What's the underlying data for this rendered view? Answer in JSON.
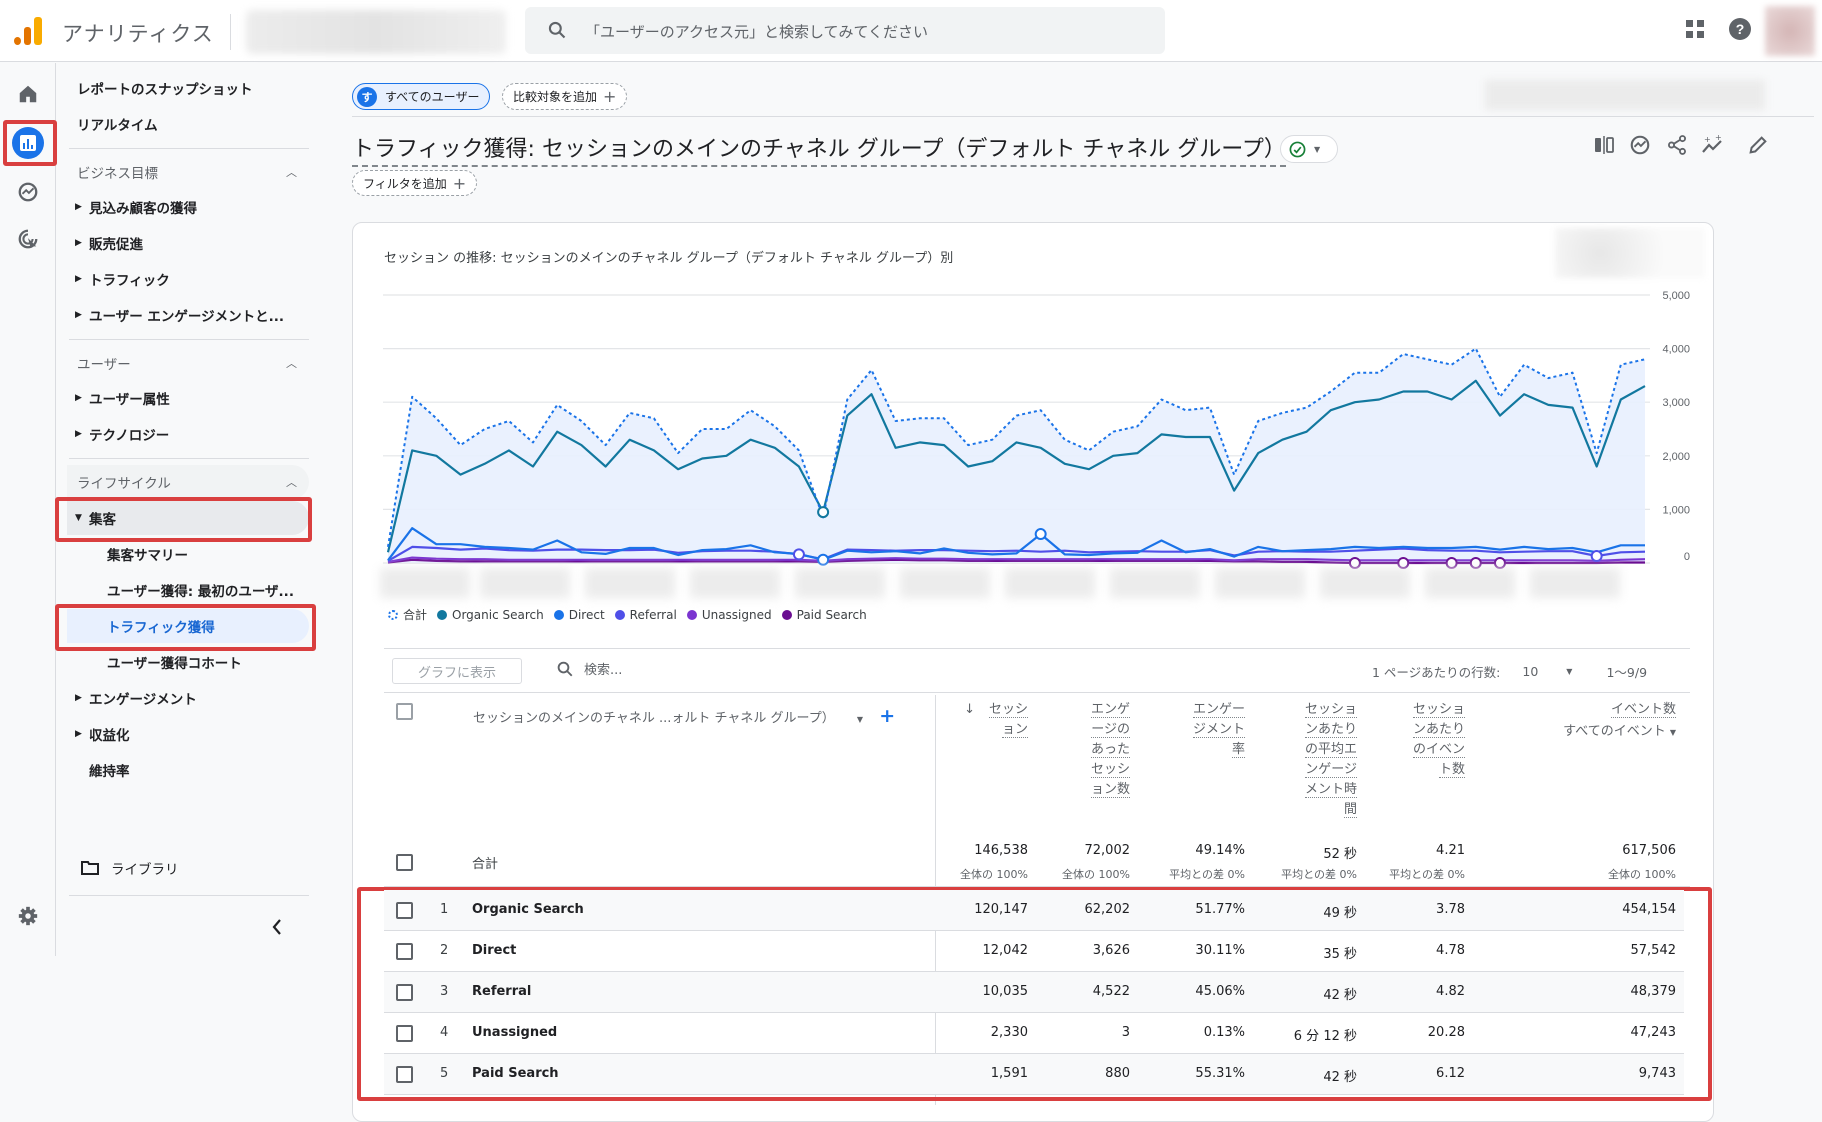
{
  "app": {
    "title": "アナリティクス",
    "search_placeholder": "「ユーザーのアクセス元」と検索してみてください",
    "brand_colors": {
      "orange": "#f9ab00",
      "dark_orange": "#e37400",
      "accent": "#1a73e8"
    }
  },
  "rail": {
    "items": [
      {
        "name": "home",
        "icon": "home-icon"
      },
      {
        "name": "reports",
        "icon": "bar-chart-icon",
        "active": true
      },
      {
        "name": "explore",
        "icon": "explore-trend-icon"
      },
      {
        "name": "advertising",
        "icon": "target-cursor-icon"
      },
      {
        "name": "admin",
        "icon": "gear-icon"
      }
    ]
  },
  "nav": {
    "top_items": [
      "レポートのスナップショット",
      "リアルタイム"
    ],
    "sections": [
      {
        "label": "ビジネス目標",
        "items": [
          "見込み顧客の獲得",
          "販売促進",
          "トラフィック",
          "ユーザー エンゲージメントと..."
        ]
      },
      {
        "label": "ユーザー",
        "items": [
          "ユーザー属性",
          "テクノロジー"
        ]
      },
      {
        "label": "ライフサイクル",
        "expanded_item": "集客",
        "sub_items": [
          "集客サマリー",
          "ユーザー獲得: 最初のユーザ...",
          "トラフィック獲得",
          "ユーザー獲得コホート"
        ],
        "active_sub_item": "トラフィック獲得",
        "items_after": [
          "エンゲージメント",
          "収益化",
          "維持率"
        ]
      }
    ],
    "library": "ライブラリ"
  },
  "header": {
    "segment_chip": "すべてのユーザー",
    "segment_badge": "す",
    "compare_chip": "比較対象を追加",
    "page_title": "トラフィック獲得: セッションのメインのチャネル グループ（デフォルト チャネル グループ）",
    "filter_chip": "フィルタを追加"
  },
  "chart_data": {
    "type": "line",
    "title": "セッション の推移: セッションのメインのチャネル グループ（デフォルト チャネル グループ）別",
    "xlabel": "",
    "ylabel": "",
    "ylim": [
      0,
      5000
    ],
    "y_ticks": [
      "5,000",
      "4,000",
      "3,000",
      "2,000",
      "1,000",
      "0"
    ],
    "y_tick_values": [
      5000,
      4000,
      3000,
      2000,
      1000,
      0
    ],
    "grid": true,
    "legend_position": "bottom-left",
    "x_tick_labels_visible": false,
    "series": [
      {
        "name": "合計",
        "color": "#1a73e8",
        "style": "dotted",
        "fill": "#e8f0fe",
        "values": [
          300,
          3100,
          2700,
          2200,
          2500,
          2650,
          2250,
          2950,
          2650,
          2200,
          2800,
          2700,
          2050,
          2500,
          2500,
          2850,
          2550,
          2100,
          850,
          3050,
          3600,
          2650,
          2700,
          2700,
          2200,
          2300,
          2750,
          2850,
          2300,
          2100,
          2450,
          2550,
          3050,
          2850,
          2900,
          1650,
          2650,
          2800,
          2900,
          3200,
          3550,
          3550,
          3900,
          3800,
          3700,
          4000,
          3100,
          3700,
          3450,
          3550,
          2050,
          3700,
          3800
        ]
      },
      {
        "name": "Organic Search",
        "color": "#12789f",
        "style": "solid",
        "values": [
          200,
          2100,
          2000,
          1650,
          1850,
          2100,
          1800,
          2450,
          2200,
          1800,
          2300,
          2100,
          1750,
          1950,
          2000,
          2300,
          2150,
          1800,
          950,
          2750,
          3150,
          2150,
          2250,
          2200,
          1800,
          1900,
          2250,
          2150,
          1850,
          1750,
          2000,
          2050,
          2400,
          2350,
          2350,
          1350,
          2050,
          2300,
          2450,
          2850,
          3000,
          3050,
          3200,
          3200,
          3050,
          3400,
          2750,
          3150,
          2950,
          2900,
          1800,
          3050,
          3300
        ]
      },
      {
        "name": "Direct",
        "color": "#1a73e8",
        "style": "solid",
        "values": [
          50,
          650,
          350,
          350,
          300,
          280,
          250,
          420,
          200,
          170,
          280,
          280,
          150,
          240,
          260,
          330,
          200,
          170,
          60,
          230,
          200,
          220,
          180,
          270,
          190,
          160,
          180,
          540,
          160,
          150,
          180,
          190,
          420,
          200,
          260,
          120,
          300,
          220,
          240,
          260,
          300,
          280,
          300,
          280,
          280,
          300,
          250,
          300,
          260,
          280,
          200,
          330,
          330
        ]
      },
      {
        "name": "Referral",
        "color": "#4f4fe8",
        "style": "solid",
        "values": [
          40,
          300,
          280,
          250,
          270,
          240,
          230,
          250,
          250,
          240,
          240,
          250,
          190,
          220,
          230,
          230,
          210,
          160,
          70,
          250,
          240,
          230,
          240,
          240,
          230,
          220,
          230,
          210,
          230,
          200,
          210,
          220,
          210,
          210,
          240,
          140,
          210,
          220,
          210,
          210,
          230,
          250,
          270,
          240,
          230,
          230,
          200,
          210,
          220,
          220,
          130,
          200,
          210
        ]
      },
      {
        "name": "Unassigned",
        "color": "#7b35d0",
        "style": "solid",
        "values": [
          20,
          100,
          80,
          70,
          70,
          60,
          60,
          60,
          60,
          60,
          60,
          60,
          60,
          60,
          60,
          60,
          60,
          60,
          40,
          70,
          80,
          90,
          80,
          80,
          70,
          70,
          70,
          70,
          70,
          70,
          70,
          70,
          70,
          70,
          70,
          50,
          70,
          70,
          70,
          60,
          50,
          50,
          50,
          50,
          50,
          50,
          50,
          50,
          50,
          50,
          40,
          60,
          70
        ]
      },
      {
        "name": "Paid Search",
        "color": "#6a0d91",
        "style": "solid",
        "values": [
          10,
          60,
          40,
          30,
          30,
          30,
          30,
          30,
          30,
          30,
          30,
          30,
          30,
          30,
          30,
          30,
          30,
          30,
          20,
          40,
          50,
          60,
          50,
          50,
          40,
          40,
          40,
          40,
          40,
          40,
          40,
          40,
          40,
          40,
          40,
          30,
          30,
          20,
          20,
          10,
          0,
          0,
          0,
          0,
          0,
          0,
          0,
          0,
          0,
          0,
          0,
          10,
          10
        ]
      }
    ]
  },
  "legend": [
    {
      "label": "合計",
      "color": "#1a73e8",
      "dotted": true
    },
    {
      "label": "Organic Search",
      "color": "#12789f"
    },
    {
      "label": "Direct",
      "color": "#1a73e8"
    },
    {
      "label": "Referral",
      "color": "#4f4fe8"
    },
    {
      "label": "Unassigned",
      "color": "#7b35d0"
    },
    {
      "label": "Paid Search",
      "color": "#6a0d91"
    }
  ],
  "table": {
    "plot_button": "グラフに表示",
    "search_placeholder": "検索...",
    "rows_per_page_label": "1 ページあたりの行数:",
    "rows_per_page": "10",
    "pagination": "1〜9/9",
    "dimension_header": "セッションのメインのチャネル ...ォルト チャネル グループ）",
    "columns": [
      {
        "lines": [
          "セッシ",
          "ョン"
        ],
        "sorted": true
      },
      {
        "lines": [
          "エンゲ",
          "ージの",
          "あった",
          "セッシ",
          "ョン数"
        ]
      },
      {
        "lines": [
          "エンゲー",
          "ジメント",
          "率"
        ]
      },
      {
        "lines": [
          "セッショ",
          "ンあたり",
          "の平均エ",
          "ンゲージ",
          "メント時",
          "間"
        ]
      },
      {
        "lines": [
          "セッショ",
          "ンあたり",
          "のイベン",
          "ト数"
        ]
      },
      {
        "lines": [
          "イベント数"
        ],
        "sub": "すべてのイベント"
      }
    ],
    "totals": {
      "label": "合計",
      "values": [
        "146,538",
        "72,002",
        "49.14%",
        "52 秒",
        "4.21",
        "617,506"
      ],
      "subs": [
        "全体の 100%",
        "全体の 100%",
        "平均との差 0%",
        "平均との差 0%",
        "平均との差 0%",
        "全体の 100%"
      ]
    },
    "rows": [
      {
        "rank": "1",
        "channel": "Organic Search",
        "values": [
          "120,147",
          "62,202",
          "51.77%",
          "49 秒",
          "3.78",
          "454,154"
        ]
      },
      {
        "rank": "2",
        "channel": "Direct",
        "values": [
          "12,042",
          "3,626",
          "30.11%",
          "35 秒",
          "4.78",
          "57,542"
        ]
      },
      {
        "rank": "3",
        "channel": "Referral",
        "values": [
          "10,035",
          "4,522",
          "45.06%",
          "42 秒",
          "4.82",
          "48,379"
        ]
      },
      {
        "rank": "4",
        "channel": "Unassigned",
        "values": [
          "2,330",
          "3",
          "0.13%",
          "6 分 12 秒",
          "20.28",
          "47,243"
        ]
      },
      {
        "rank": "5",
        "channel": "Paid Search",
        "values": [
          "1,591",
          "880",
          "55.31%",
          "42 秒",
          "6.12",
          "9,743"
        ]
      }
    ]
  }
}
